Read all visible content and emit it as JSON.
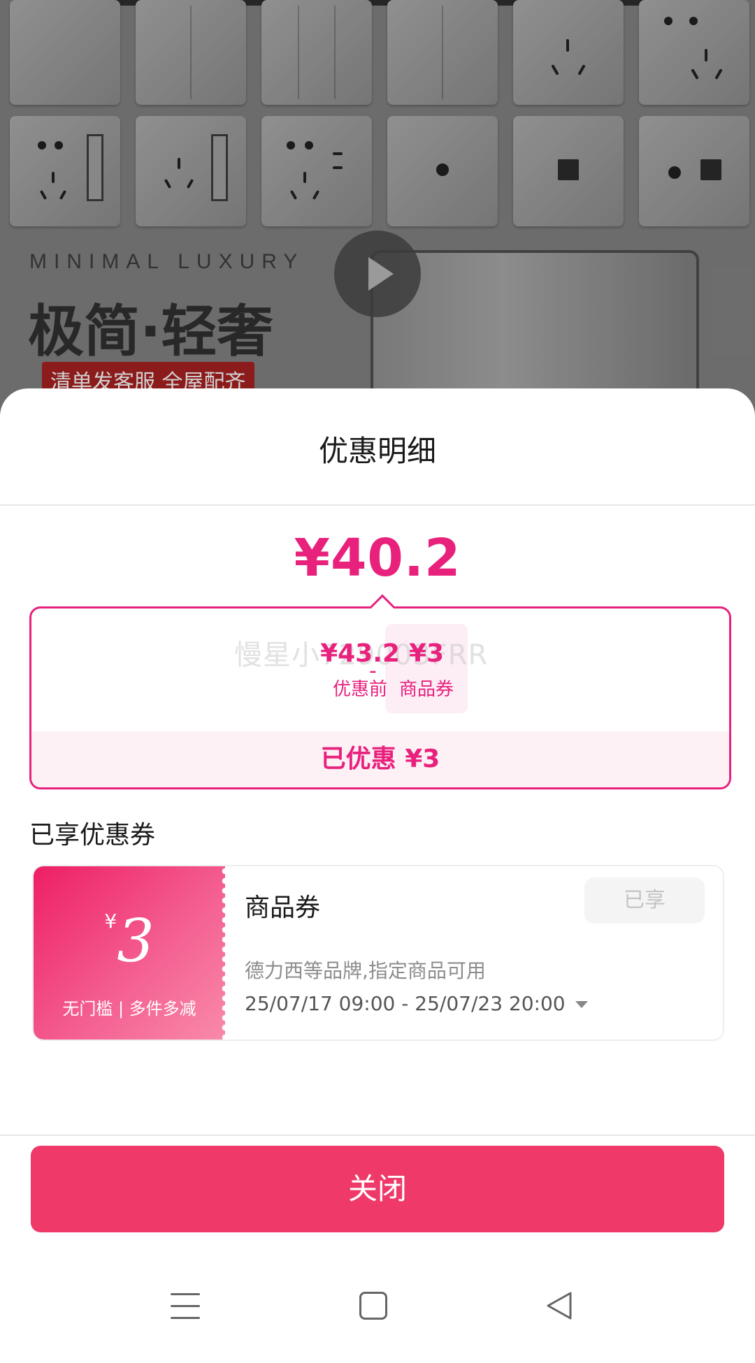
{
  "background": {
    "headline_en": "MINIMAL LUXURY",
    "headline_cn": "极简·轻奢",
    "tag": "清单发客服 全屋配齐"
  },
  "sheet": {
    "title": "优惠明细",
    "final_price": "¥40.2",
    "watermark": "慢星小729003FRR",
    "breakdown": {
      "original_value": "¥43.2",
      "original_label": "优惠前",
      "operator": "-",
      "coupon_value": "¥3",
      "coupon_label": "商品券",
      "saved_text": "已优惠 ¥3"
    },
    "section_label": "已享优惠券",
    "coupon": {
      "currency": "¥",
      "amount": "3",
      "condition": "无门槛 | 多件多减",
      "name": "商品券",
      "status": "已享",
      "description": "德力西等品牌,指定商品可用",
      "period": "25/07/17 09:00 - 25/07/23 20:00"
    },
    "close_label": "关闭"
  },
  "colors": {
    "accent": "#e8217d",
    "button": "#ee3969",
    "coupon_gradient_start": "#ee1f64",
    "coupon_gradient_end": "#f98aa9"
  },
  "icons": {
    "play": "play-icon",
    "nav_menu": "menu-icon",
    "nav_home": "home-icon",
    "nav_back": "back-icon",
    "expand": "chevron-down-icon"
  }
}
